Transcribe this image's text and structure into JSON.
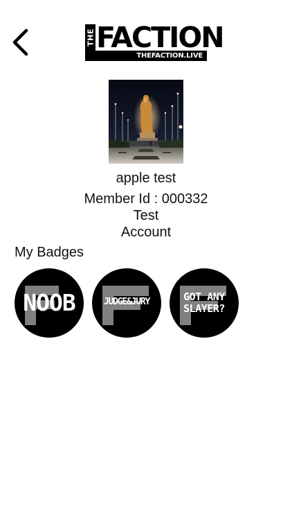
{
  "header": {
    "back_icon": "chevron-left-icon",
    "logo": {
      "the": "THE",
      "main": "FACTION",
      "sub": "THEFACTION.LIVE"
    }
  },
  "profile": {
    "name": "apple test",
    "member_id": "Member Id : 000332",
    "account_line1": "Test",
    "account_line2": "Account"
  },
  "badges": {
    "heading": "My Badges",
    "items": [
      {
        "label": "NOOB"
      },
      {
        "label": "JUDGE&JURY"
      },
      {
        "label_line1": "GOT ANY",
        "label_line2": "SLAYER?"
      }
    ]
  },
  "colors": {
    "badge_bg": "#000000",
    "badge_mark": "#808080",
    "text": "#111111"
  }
}
